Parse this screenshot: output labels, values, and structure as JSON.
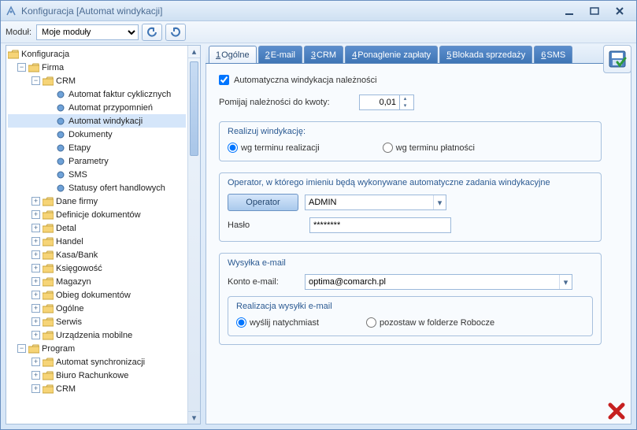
{
  "window": {
    "title": "Konfiguracja [Automat windykacji]"
  },
  "toolbar": {
    "module_label": "Moduł:",
    "module_selected": "Moje moduły"
  },
  "tree": {
    "root": "Konfiguracja",
    "firma": "Firma",
    "crm": "CRM",
    "crm_children": [
      "Automat faktur cyklicznych",
      "Automat przypomnień",
      "Automat windykacji",
      "Dokumenty",
      "Etapy",
      "Parametry",
      "SMS",
      "Statusy ofert handlowych"
    ],
    "firma_children": [
      "Dane firmy",
      "Definicje dokumentów",
      "Detal",
      "Handel",
      "Kasa/Bank",
      "Księgowość",
      "Magazyn",
      "Obieg dokumentów",
      "Ogólne",
      "Serwis",
      "Urządzenia mobilne"
    ],
    "program": "Program",
    "program_children": [
      "Automat synchronizacji",
      "Biuro Rachunkowe",
      "CRM"
    ]
  },
  "tabs": [
    {
      "key": "1",
      "label": "Ogólne"
    },
    {
      "key": "2",
      "label": "E-mail"
    },
    {
      "key": "3",
      "label": "CRM"
    },
    {
      "key": "4",
      "label": "Ponaglenie zapłaty"
    },
    {
      "key": "5",
      "label": "Blokada sprzedaży"
    },
    {
      "key": "6",
      "label": "SMS"
    }
  ],
  "content": {
    "auto_windykacja": "Automatyczna windykacja należności",
    "pomijaj_label": "Pomijaj należności do kwoty:",
    "pomijaj_value": "0,01",
    "realizuj_legend": "Realizuj windykację:",
    "realizuj_opt1": "wg terminu realizacji",
    "realizuj_opt2": "wg terminu płatności",
    "operator_legend": "Operator, w którego imieniu będą wykonywane automatyczne zadania windykacyjne",
    "operator_btn": "Operator",
    "operator_value": "ADMIN",
    "haslo_label": "Hasło",
    "haslo_value": "********",
    "email_legend": "Wysyłka e-mail",
    "email_acct_label": "Konto e-mail:",
    "email_acct_value": "optima@comarch.pl",
    "email_real_legend": "Realizacja wysyłki e-mail",
    "email_opt1": "wyślij natychmiast",
    "email_opt2": "pozostaw w folderze Robocze"
  }
}
